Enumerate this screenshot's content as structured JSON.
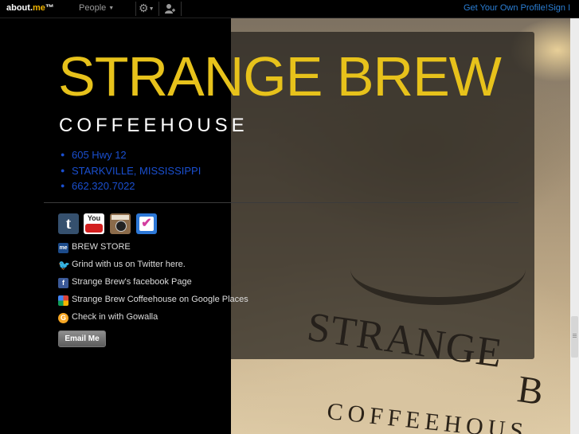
{
  "topbar": {
    "logo_prefix": "about.",
    "logo_me": "me",
    "logo_tm": "™",
    "people_label": "People",
    "get_profile_label": "Get Your Own Profile!",
    "signin_label": "Sign I"
  },
  "profile": {
    "title": "STRANGE BREW",
    "subtitle": "COFFEEHOUSE",
    "address": [
      "605 Hwy 12",
      "STARKVILLE, MISSISSIPPI",
      "662.320.7022"
    ],
    "social_icons": [
      "tumblr-icon",
      "youtube-icon",
      "instagram-icon",
      "foursquare-icon"
    ],
    "youtube_text": "You Tube",
    "links": [
      {
        "icon": "aboutme-icon",
        "label": "BREW STORE"
      },
      {
        "icon": "twitter-icon",
        "label": "Grind with us on Twitter here."
      },
      {
        "icon": "facebook-icon",
        "label": "Strange Brew's facebook Page"
      },
      {
        "icon": "google-places-icon",
        "label": "Strange Brew Coffeehouse on Google Places"
      },
      {
        "icon": "gowalla-icon",
        "label": "Check in with Gowalla"
      }
    ],
    "email_button": "Email Me"
  },
  "background_photo": {
    "text_line1": "STRANGE",
    "text_line2": "B",
    "text_line3": "COFFEEHOUS"
  },
  "colors": {
    "title": "#e7c21b",
    "link_blue": "#1a4fcf",
    "topbar_link": "#2b7fd5"
  }
}
